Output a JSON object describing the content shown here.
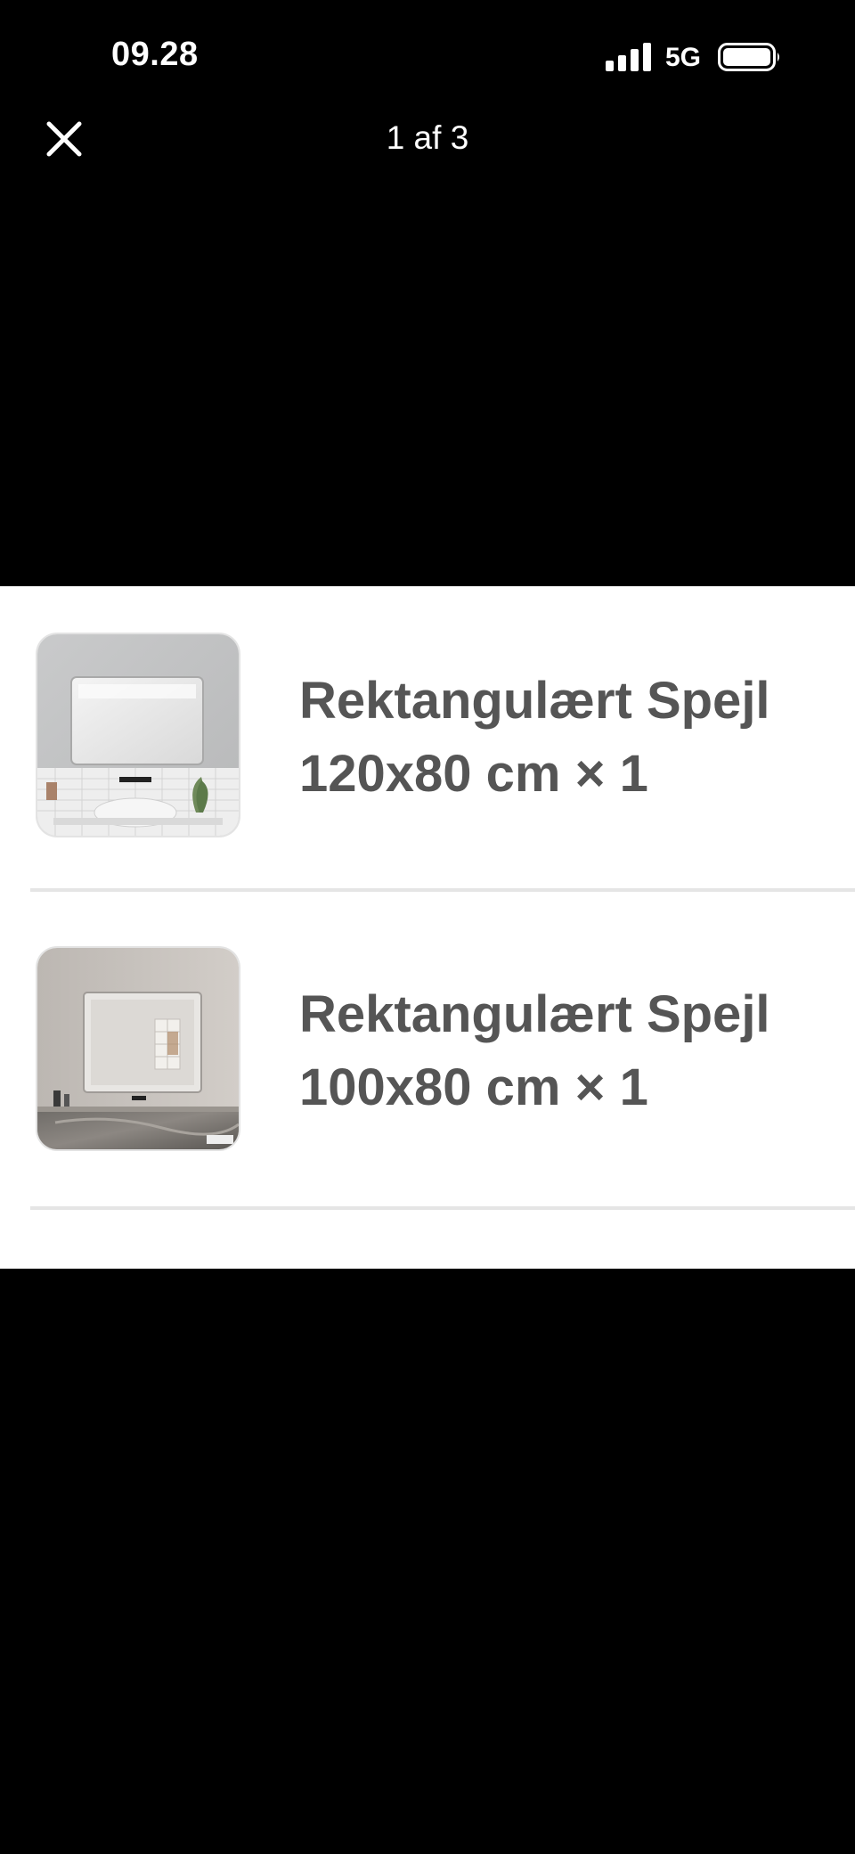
{
  "status_bar": {
    "time": "09.28",
    "network": "5G",
    "signal_icon": "cellular-signal-icon",
    "battery_icon": "battery-icon"
  },
  "viewer": {
    "close_icon": "close-icon",
    "page_counter": "1 af 3"
  },
  "items": [
    {
      "name_line1": "Rektangulært Spejl",
      "name_line2": "120x80 cm × 1",
      "image": "product-image"
    },
    {
      "name_line1": "Rektangulært Spejl",
      "name_line2": "100x80 cm × 1",
      "image": "product-image"
    }
  ],
  "colors": {
    "background": "#000000",
    "sheet": "#ffffff",
    "item_text": "#555555",
    "divider": "#e5e5e5"
  }
}
